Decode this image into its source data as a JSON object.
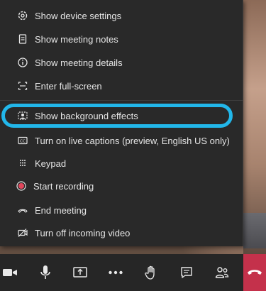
{
  "menu": {
    "items": [
      {
        "label": "Show device settings",
        "icon": "gear-icon"
      },
      {
        "label": "Show meeting notes",
        "icon": "notes-icon"
      },
      {
        "label": "Show meeting details",
        "icon": "info-icon"
      },
      {
        "label": "Enter full-screen",
        "icon": "fullscreen-icon"
      },
      {
        "label": "Show background effects",
        "icon": "background-effects-icon"
      },
      {
        "label": "Turn on live captions (preview, English US only)",
        "icon": "captions-icon"
      },
      {
        "label": "Keypad",
        "icon": "keypad-icon"
      },
      {
        "label": "Start recording",
        "icon": "record-icon"
      },
      {
        "label": "End meeting",
        "icon": "end-call-icon"
      },
      {
        "label": "Turn off incoming video",
        "icon": "video-off-icon"
      }
    ]
  },
  "toolbar": {
    "buttons": [
      {
        "name": "camera-button",
        "icon": "camera-icon"
      },
      {
        "name": "mic-button",
        "icon": "microphone-icon"
      },
      {
        "name": "share-button",
        "icon": "share-screen-icon"
      },
      {
        "name": "more-actions-button",
        "icon": "more-dots-icon"
      },
      {
        "name": "raise-hand-button",
        "icon": "hand-icon"
      },
      {
        "name": "chat-button",
        "icon": "chat-icon"
      },
      {
        "name": "participants-button",
        "icon": "participants-icon"
      },
      {
        "name": "hang-up-button",
        "icon": "phone-hangup-icon"
      }
    ]
  },
  "colors": {
    "menu_background": "#292929",
    "menu_text": "#e6e6e6",
    "highlight": "#22b7ea",
    "record_red": "#e0475c",
    "hangup_red": "#c4314b",
    "toolbar_background": "#262626"
  }
}
